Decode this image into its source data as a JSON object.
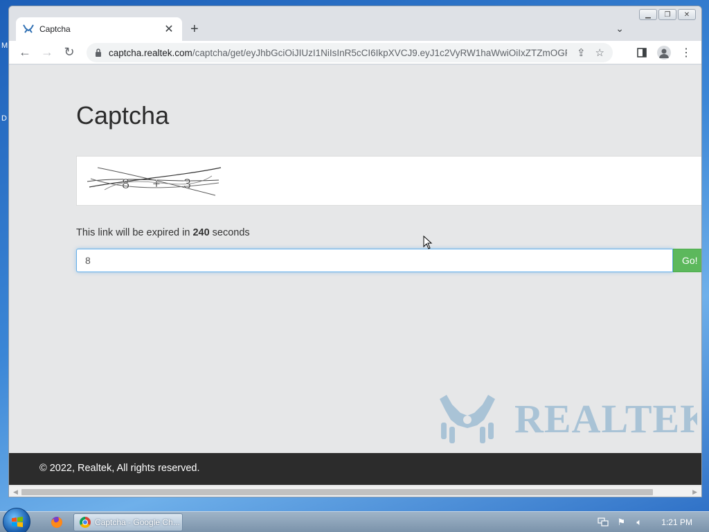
{
  "browser": {
    "tab_title": "Captcha",
    "new_tab_label": "+",
    "url_host": "captcha.realtek.com",
    "url_path": "/captcha/get/eyJhbGciOiJIUzI1NiIsInR5cCI6IkpXVCJ9.eyJ1c2VyRW1haWwiOiIxZTZmOGFl..."
  },
  "page": {
    "heading": "Captcha",
    "captcha_image_text": "8 + 3",
    "expire_prefix": "This link will be expired in ",
    "expire_seconds": "240",
    "expire_suffix": " seconds",
    "answer_value": "8",
    "go_label": "Go!",
    "logo_text": "REALTEK",
    "footer_text": "© 2022, Realtek, All rights reserved."
  },
  "taskbar": {
    "chrome_label": "Captcha - Google Ch...",
    "clock": "1:21 PM"
  },
  "colors": {
    "go_button": "#5cb85c",
    "footer_bg": "#2c2c2c",
    "page_bg": "#e6e7e8",
    "logo": "#a9c3d6"
  }
}
